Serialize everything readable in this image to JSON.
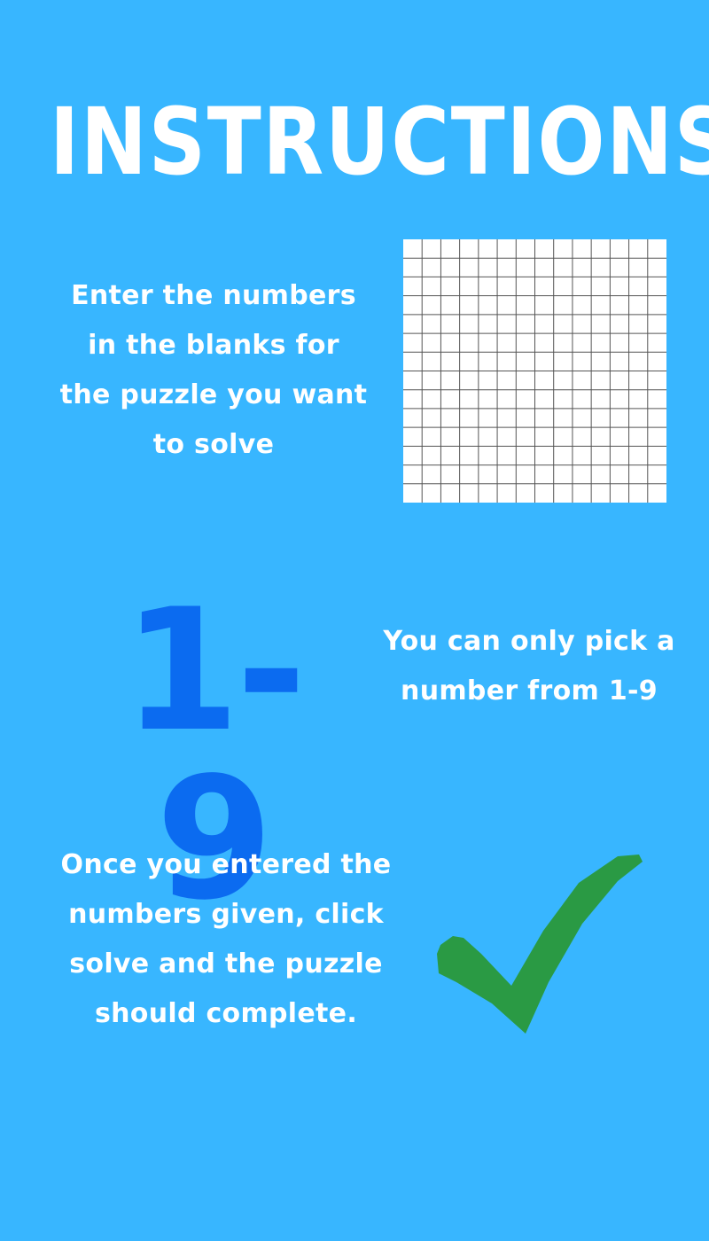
{
  "title": "INSTRUCTIONS",
  "steps": [
    {
      "text": "Enter the numbers\nin the blanks for\nthe puzzle you want\nto solve",
      "visual": "grid-icon"
    },
    {
      "big_text": "1-9",
      "text": "You can only pick a\nnumber from 1-9"
    },
    {
      "text": "Once you entered the\nnumbers given, click\nsolve and the puzzle\nshould complete.",
      "visual": "checkmark-icon"
    }
  ],
  "colors": {
    "background": "#38b6ff",
    "text": "#ffffff",
    "range_number": "#0b6bf0",
    "checkmark": "#2a9a44",
    "grid_fill": "#ffffff",
    "grid_lines": "#555555"
  }
}
